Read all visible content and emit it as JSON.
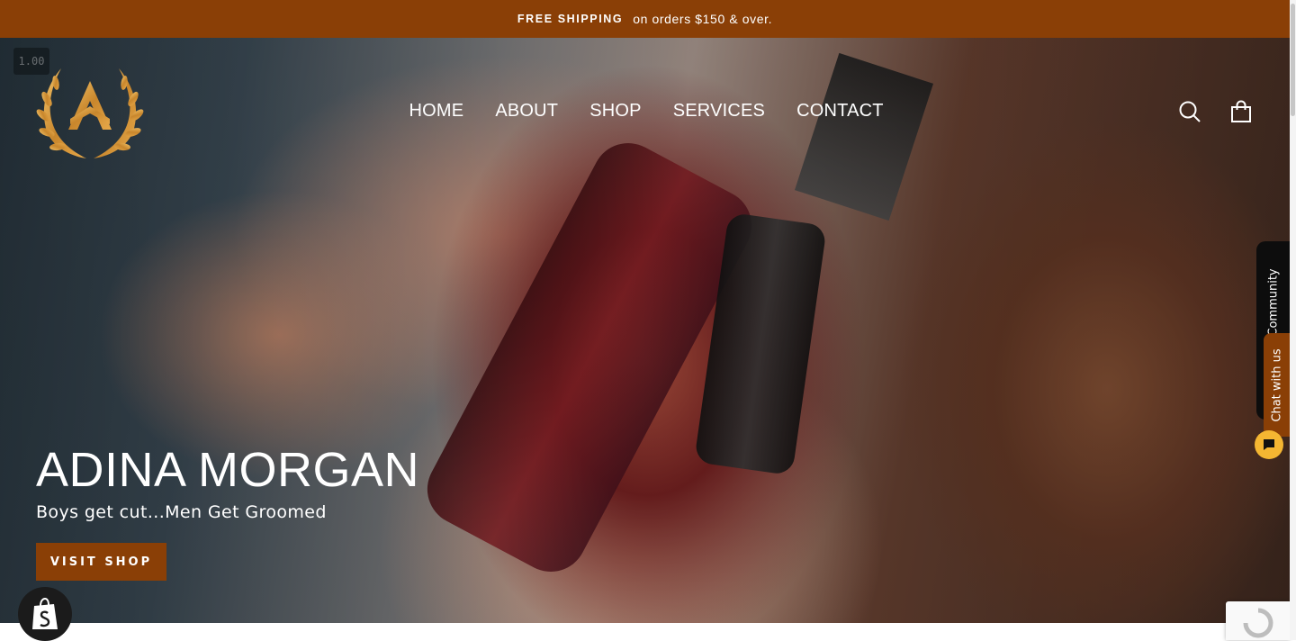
{
  "announcement": {
    "bold": "FREE SHIPPING",
    "text": "on orders $150 & over."
  },
  "video": {
    "playback_rate": "1.00"
  },
  "header": {
    "logo": "crown-a-laurel-logo",
    "nav": [
      {
        "label": "HOME"
      },
      {
        "label": "ABOUT"
      },
      {
        "label": "SHOP"
      },
      {
        "label": "SERVICES"
      },
      {
        "label": "CONTACT"
      }
    ],
    "icons": [
      "search-icon",
      "cart-icon"
    ]
  },
  "hero": {
    "title": "ADINA MORGAN",
    "subtitle": "Boys get cut...Men Get Groomed",
    "cta": "VISIT SHOP"
  },
  "widgets": {
    "community_label": "Community",
    "chat_label": "Chat with us"
  },
  "colors": {
    "brand": "#8a3f06",
    "gold": "#d9a04a",
    "chat_bubble": "#f4b632"
  }
}
